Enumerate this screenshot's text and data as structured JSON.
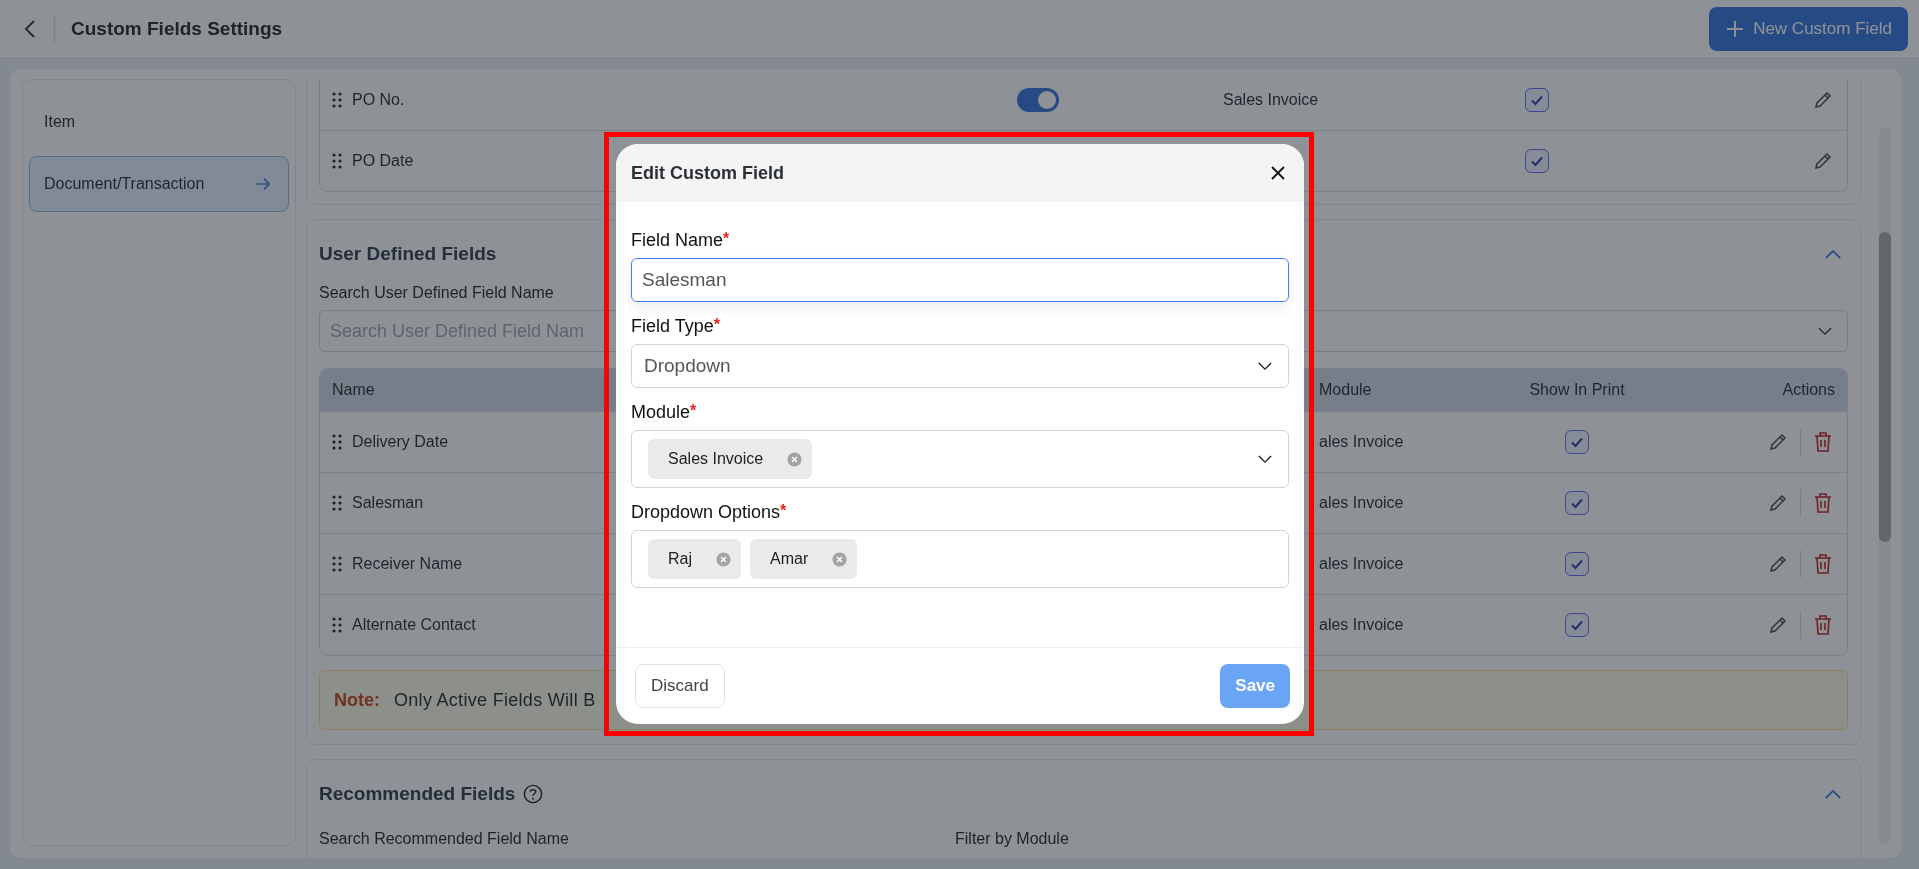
{
  "header": {
    "title": "Custom Fields Settings",
    "new_button": "New Custom Field"
  },
  "sidebar": {
    "items": [
      {
        "label": "Item",
        "selected": false
      },
      {
        "label": "Document/Transaction",
        "selected": true
      }
    ]
  },
  "standard_fields": {
    "rows": [
      {
        "name": "PO No.",
        "active": true,
        "module": "Sales Invoice",
        "show_in_print": true
      },
      {
        "name": "PO Date",
        "show_in_print": true
      }
    ]
  },
  "user_defined": {
    "title": "User Defined Fields",
    "expanded": true,
    "search_label": "Search User Defined Field Name",
    "search_placeholder": "Search User Defined Field Nam",
    "columns": [
      "Name",
      "Module",
      "Show In Print",
      "Actions"
    ],
    "rows": [
      {
        "name": "Delivery Date",
        "module": "ales Invoice",
        "show_in_print": true
      },
      {
        "name": "Salesman",
        "module": "ales Invoice",
        "show_in_print": true
      },
      {
        "name": "Receiver Name",
        "module": "ales Invoice",
        "show_in_print": true
      },
      {
        "name": "Alternate Contact",
        "module": "ales Invoice",
        "show_in_print": true
      }
    ],
    "note": {
      "label": "Note:",
      "text": "Only Active Fields Will B"
    }
  },
  "recommended": {
    "title": "Recommended Fields",
    "expanded": true,
    "search_label": "Search Recommended Field Name",
    "filter_label": "Filter by Module"
  },
  "modal": {
    "title": "Edit Custom Field",
    "fields": [
      {
        "kind": "text",
        "label": "Field Name",
        "required_mark": "*",
        "value": "Salesman",
        "focused": true
      },
      {
        "kind": "select",
        "label": "Field Type",
        "required_mark": "*",
        "value": "Dropdown"
      },
      {
        "kind": "chips",
        "label": "Module",
        "required_mark": "*",
        "chips": [
          "Sales Invoice"
        ],
        "dropdown": true
      },
      {
        "kind": "chips",
        "label": "Dropdown Options",
        "required_mark": "*",
        "chips": [
          "Raj",
          "Amar"
        ],
        "dropdown": false
      }
    ],
    "discard": "Discard",
    "save": "Save",
    "save_disabled": true
  }
}
